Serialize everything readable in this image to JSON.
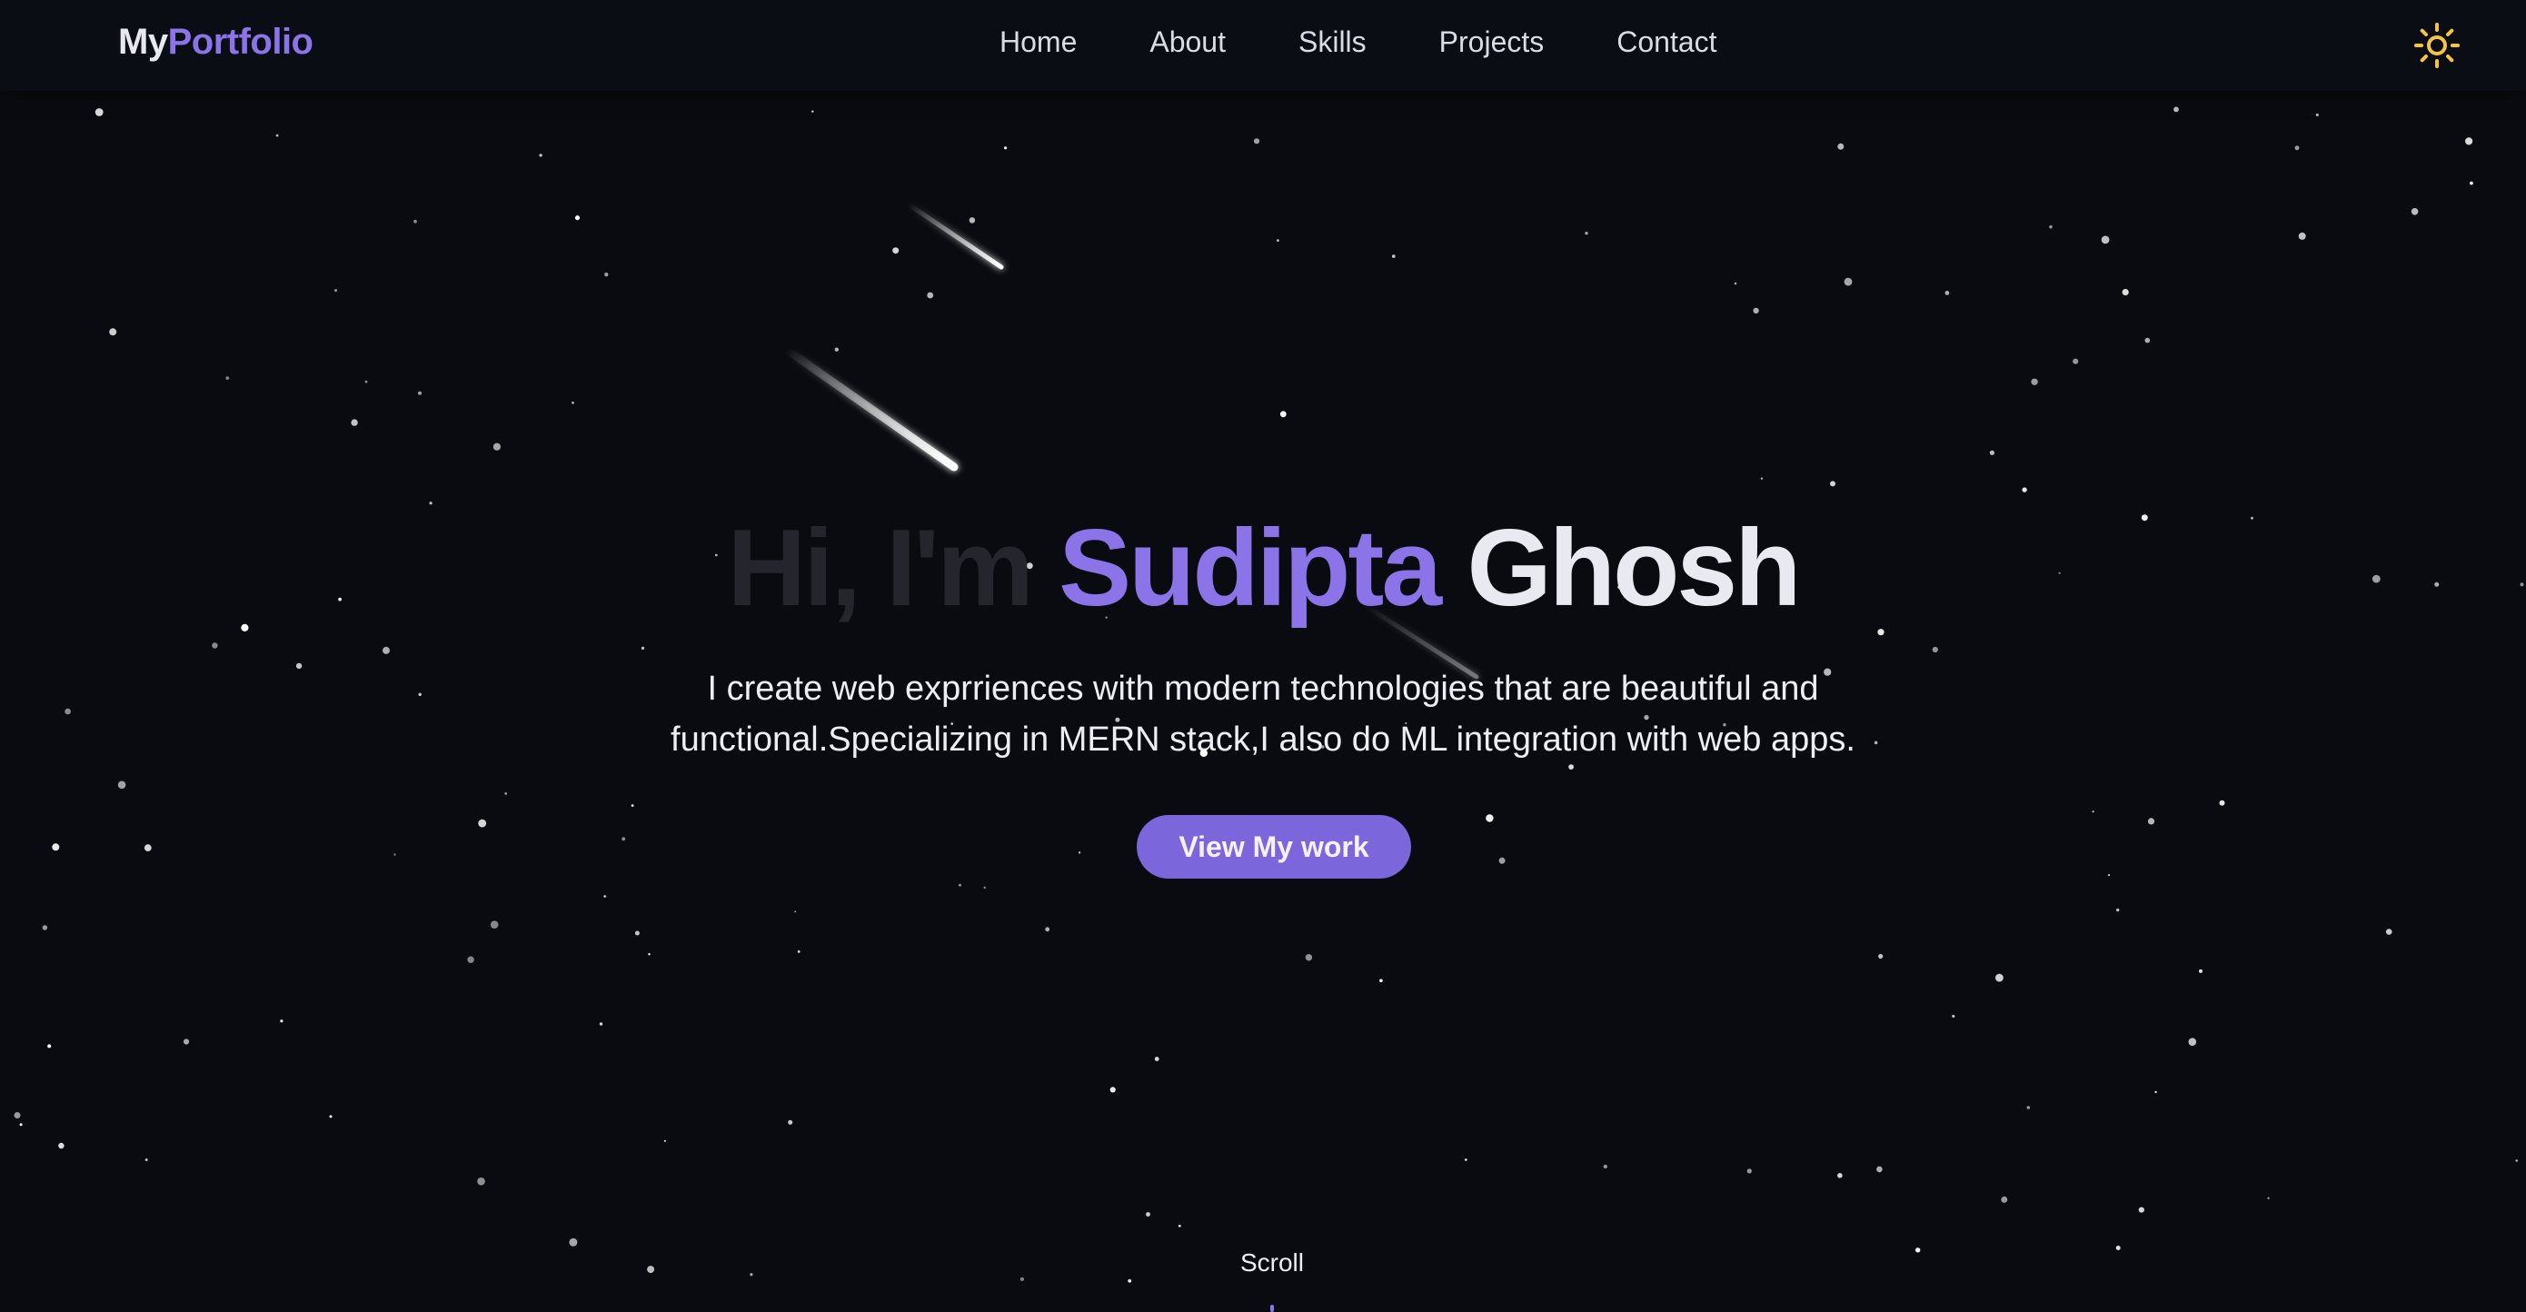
{
  "navbar": {
    "logo_part1": "My",
    "logo_part2": "Portfolio",
    "links": [
      {
        "label": "Home"
      },
      {
        "label": "About"
      },
      {
        "label": "Skills"
      },
      {
        "label": "Projects"
      },
      {
        "label": "Contact"
      }
    ],
    "theme_toggle_icon": "sun-icon"
  },
  "hero": {
    "greeting": "Hi, I'm",
    "first_name": "Sudipta",
    "last_name": "Ghosh",
    "description": "I create web exprriences with modern technologies that are beautiful and functional.Specializing in MERN stack,I also do ML integration with web apps.",
    "cta_label": "View My work",
    "scroll_label": "Scroll"
  },
  "colors": {
    "background": "#0a0b10",
    "accent": "#8b73e8",
    "button": "#7c66db",
    "sun": "#f5c542",
    "text": "#eceef5"
  }
}
